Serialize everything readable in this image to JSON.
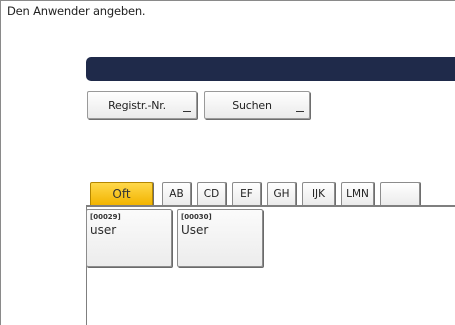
{
  "instruction": "Den Anwender angeben.",
  "buttons": {
    "registr_nr": "Registr.-Nr.",
    "suchen": "Suchen"
  },
  "tabs": [
    {
      "label": "Oft",
      "active": true
    },
    {
      "label": "AB",
      "active": false
    },
    {
      "label": "CD",
      "active": false
    },
    {
      "label": "EF",
      "active": false
    },
    {
      "label": "GH",
      "active": false
    },
    {
      "label": "IJK",
      "active": false
    },
    {
      "label": "LMN",
      "active": false
    },
    {
      "label": "",
      "active": false
    }
  ],
  "users": [
    {
      "code": "[00029]",
      "name": "user"
    },
    {
      "code": "[00030]",
      "name": "User"
    }
  ],
  "colors": {
    "header_bar": "#1f2a4a",
    "active_tab": "#f5bd0a"
  }
}
